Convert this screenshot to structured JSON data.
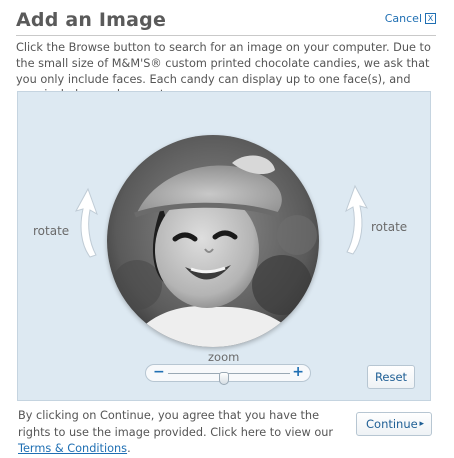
{
  "dialog": {
    "title": "Add an Image",
    "cancel_label": "Cancel",
    "cancel_icon": "X",
    "instructions": "Click the Browse button to search for an image on your computer. Due to the small size of M&M'S® custom printed chocolate candies, we ask that you only include faces. Each candy can display up to one face(s), and may include people or pets."
  },
  "editor": {
    "rotate_left_label": "rotate",
    "rotate_right_label": "rotate",
    "zoom_label": "zoom",
    "zoom_minus": "−",
    "zoom_plus": "+",
    "zoom_level": 0.45,
    "reset_label": "Reset",
    "photo_alt": "child wearing a hat"
  },
  "footer": {
    "agreement_prefix": "By clicking on Continue, you agree that you have the rights to use the image provided.  Click here to view our ",
    "terms_link": "Terms & Conditions",
    "agreement_suffix": ".",
    "continue_label": "Continue",
    "continue_icon": "▸"
  },
  "colors": {
    "accent": "#1f6fb3",
    "workspace_bg": "#dde9f2"
  }
}
